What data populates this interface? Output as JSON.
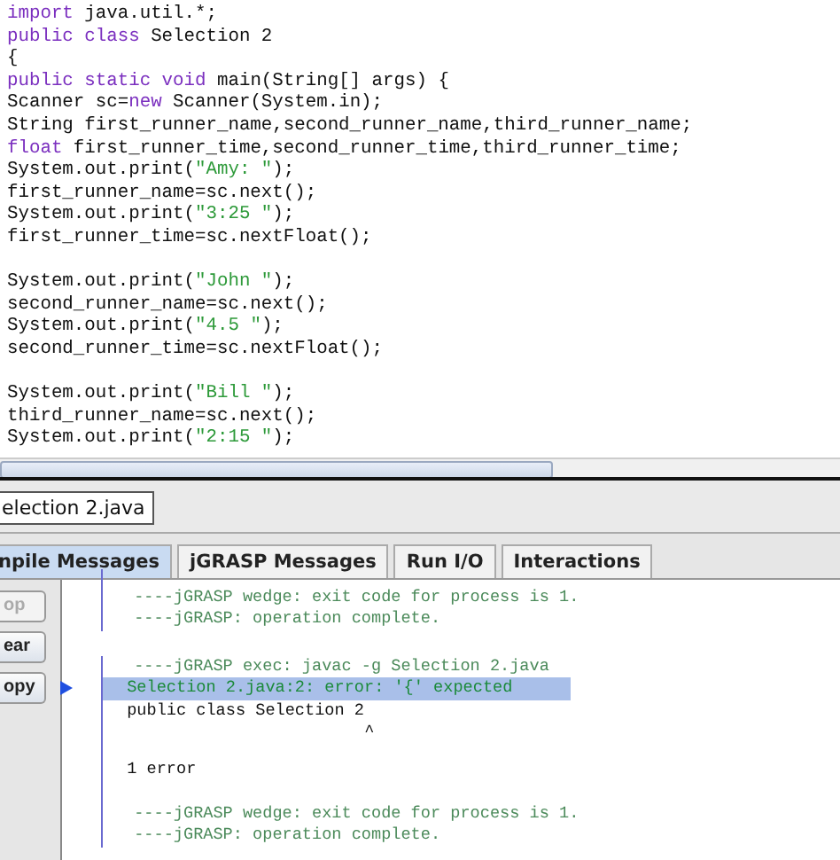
{
  "editor": {
    "blocks": [
      {
        "lines": [
          {
            "tokens": [
              {
                "kind": "keyword",
                "text": "import"
              },
              {
                "kind": "plain",
                "text": " java.util.*;"
              }
            ]
          },
          {
            "tokens": [
              {
                "kind": "keyword",
                "text": "public class"
              },
              {
                "kind": "plain",
                "text": " Selection 2"
              }
            ]
          },
          {
            "tokens": [
              {
                "kind": "plain",
                "text": "{"
              }
            ]
          },
          {
            "tokens": [
              {
                "kind": "keyword",
                "text": "public static void"
              },
              {
                "kind": "plain",
                "text": " main(String[] args) {"
              }
            ]
          },
          {
            "tokens": [
              {
                "kind": "plain",
                "text": "Scanner sc="
              },
              {
                "kind": "keyword",
                "text": "new"
              },
              {
                "kind": "plain",
                "text": " Scanner(System.in);"
              }
            ]
          },
          {
            "tokens": [
              {
                "kind": "plain",
                "text": "String first_runner_name,second_runner_name,third_runner_name;"
              }
            ]
          },
          {
            "tokens": [
              {
                "kind": "keyword",
                "text": "float"
              },
              {
                "kind": "plain",
                "text": " first_runner_time,second_runner_time,third_runner_time;"
              }
            ]
          },
          {
            "tokens": [
              {
                "kind": "plain",
                "text": "System.out.print("
              },
              {
                "kind": "string",
                "text": "\"Amy: \""
              },
              {
                "kind": "plain",
                "text": ");"
              }
            ]
          },
          {
            "tokens": [
              {
                "kind": "plain",
                "text": "first_runner_name=sc.next();"
              }
            ]
          },
          {
            "tokens": [
              {
                "kind": "plain",
                "text": "System.out.print("
              },
              {
                "kind": "string",
                "text": "\"3:25 \""
              },
              {
                "kind": "plain",
                "text": ");"
              }
            ]
          },
          {
            "tokens": [
              {
                "kind": "plain",
                "text": "first_runner_time=sc.nextFloat();"
              }
            ]
          }
        ]
      },
      {
        "lines": [
          {
            "tokens": [
              {
                "kind": "plain",
                "text": "System.out.print("
              },
              {
                "kind": "string",
                "text": "\"John \""
              },
              {
                "kind": "plain",
                "text": ");"
              }
            ]
          },
          {
            "tokens": [
              {
                "kind": "plain",
                "text": "second_runner_name=sc.next();"
              }
            ]
          },
          {
            "tokens": [
              {
                "kind": "plain",
                "text": "System.out.print("
              },
              {
                "kind": "string",
                "text": "\"4.5 \""
              },
              {
                "kind": "plain",
                "text": ");"
              }
            ]
          },
          {
            "tokens": [
              {
                "kind": "plain",
                "text": "second_runner_time=sc.nextFloat();"
              }
            ]
          }
        ]
      },
      {
        "lines": [
          {
            "tokens": [
              {
                "kind": "plain",
                "text": "System.out.print("
              },
              {
                "kind": "string",
                "text": "\"Bill \""
              },
              {
                "kind": "plain",
                "text": ");"
              }
            ]
          },
          {
            "tokens": [
              {
                "kind": "plain",
                "text": "third_runner_name=sc.next();"
              }
            ]
          },
          {
            "tokens": [
              {
                "kind": "plain",
                "text": "System.out.print("
              },
              {
                "kind": "string",
                "text": "\"2:15 \""
              },
              {
                "kind": "plain",
                "text": ");"
              }
            ]
          }
        ]
      }
    ]
  },
  "file_tab": {
    "label": "election 2.java"
  },
  "message_tabs": [
    {
      "label": "npile Messages",
      "selected": true
    },
    {
      "label": "jGRASP Messages",
      "selected": false
    },
    {
      "label": "Run I/O",
      "selected": false
    },
    {
      "label": "Interactions",
      "selected": false
    }
  ],
  "side_buttons": [
    {
      "label": "op",
      "disabled": true
    },
    {
      "label": "ear",
      "disabled": false
    },
    {
      "label": "opy",
      "disabled": false
    }
  ],
  "output_groups": [
    {
      "sections": [
        {
          "lines": [
            {
              "kind": "message",
              "text": "----jGRASP wedge: exit code for process is 1.",
              "selected": false
            },
            {
              "kind": "message",
              "text": "----jGRASP: operation complete.",
              "selected": false
            }
          ]
        }
      ]
    },
    {
      "sections": [
        {
          "lines": [
            {
              "kind": "message",
              "text": "----jGRASP exec: javac -g Selection 2.java",
              "selected": false
            },
            {
              "kind": "error",
              "text": "Selection 2.java:2: error: '{' expected",
              "selected": true
            },
            {
              "kind": "plain",
              "text": "public class Selection 2",
              "selected": false
            },
            {
              "kind": "caret",
              "text": "^",
              "selected": false
            }
          ]
        },
        {
          "lines": [
            {
              "kind": "plain",
              "text": "1 error",
              "selected": false
            }
          ]
        },
        {
          "lines": [
            {
              "kind": "message",
              "text": "----jGRASP wedge: exit code for process is 1.",
              "selected": false
            },
            {
              "kind": "message",
              "text": "----jGRASP: operation complete.",
              "selected": false
            }
          ]
        }
      ]
    }
  ]
}
